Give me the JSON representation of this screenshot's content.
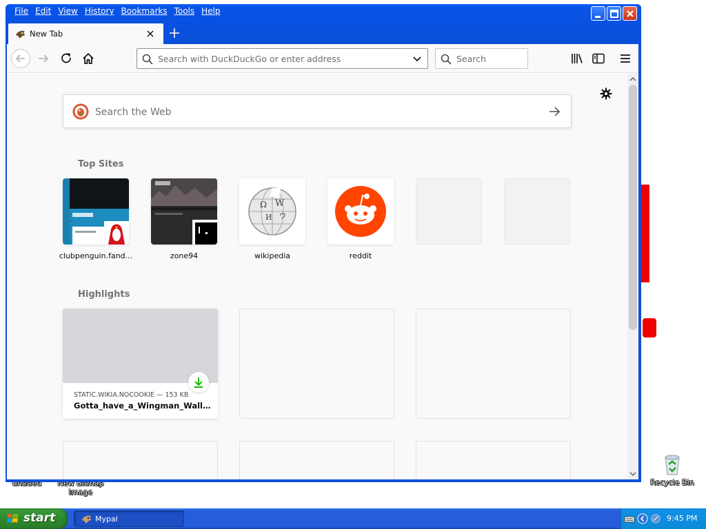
{
  "desktop": {
    "icons": [
      {
        "label": "untitled"
      },
      {
        "label": "New Bitmap Image"
      },
      {
        "label": "Recycle Bin"
      }
    ]
  },
  "window": {
    "menu": [
      "File",
      "Edit",
      "View",
      "History",
      "Bookmarks",
      "Tools",
      "Help"
    ],
    "tab": {
      "title": "New Tab"
    },
    "urlbar": {
      "placeholder": "Search with DuckDuckGo or enter address"
    },
    "searchbar": {
      "placeholder": "Search"
    },
    "toolbar_icons": [
      "back-arrow-icon",
      "forward-arrow-icon",
      "reload-icon",
      "home-icon",
      "library-icon",
      "sidebar-icon",
      "hamburger-menu-icon"
    ]
  },
  "newtab": {
    "websearch": {
      "placeholder": "Search the Web",
      "engine_icon": "duckduckgo-icon"
    },
    "top_sites": {
      "title": "Top Sites",
      "tiles": [
        {
          "label": "clubpenguin.fand..."
        },
        {
          "label": "zone94"
        },
        {
          "label": "wikipedia"
        },
        {
          "label": "reddit"
        },
        {
          "label": ""
        },
        {
          "label": ""
        }
      ]
    },
    "highlights": {
      "title": "Highlights",
      "cards": [
        {
          "source": "STATIC.WIKIA.NOCOOKIE — 153 KB",
          "title": "Gotta_have_a_Wingman_Wallpa..."
        }
      ]
    }
  },
  "taskbar": {
    "start_label": "start",
    "tasks": [
      {
        "label": "Mypal"
      }
    ],
    "clock": "9:45 PM"
  },
  "colors": {
    "xp_blue": "#0c4fe0",
    "start_green": "#2d8a2d",
    "reddit_orange": "#ff4500",
    "download_green": "#12bc00"
  }
}
